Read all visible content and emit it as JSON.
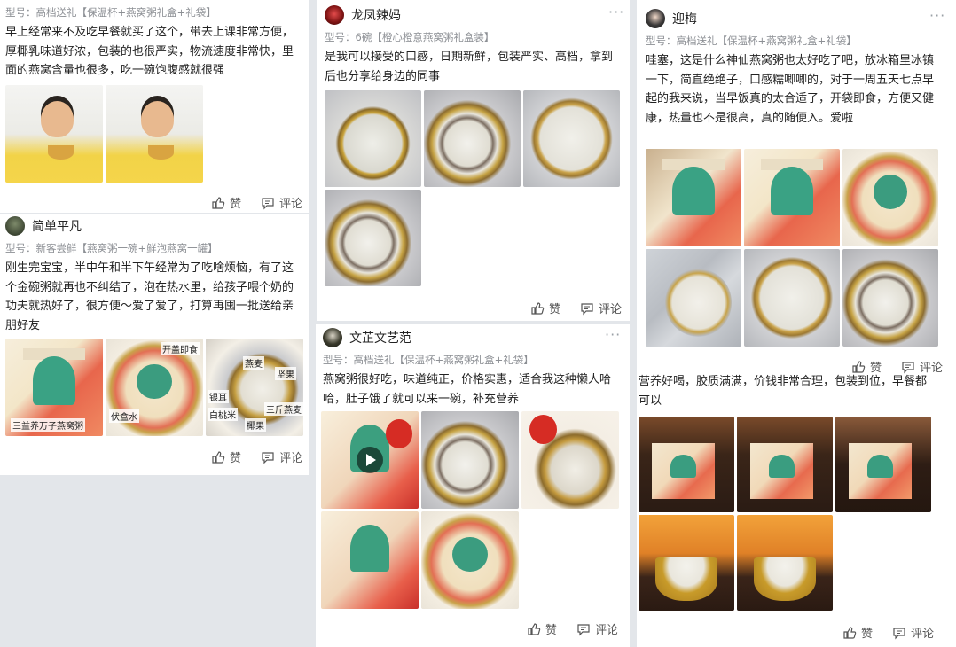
{
  "labels": {
    "like": "赞",
    "comment": "评论",
    "more": "···"
  },
  "posts": [
    {
      "model": "型号：高档送礼【保温杯+燕窝粥礼盒+礼袋】",
      "text": "早上经常来不及吃早餐就买了这个，带去上课非常方便，厚椰乳味道好浓，包装的也很严实，物流速度非常快，里面的燕窝含量也很多，吃一碗饱腹感就很强"
    },
    {
      "user": "简单平凡",
      "model": "型号：新客尝鲜【燕窝粥一碗+鲜泡燕窝一罐】",
      "text": "刚生完宝宝，半中午和半下午经常为了吃啥烦恼，有了这个金碗粥就再也不纠结了，泡在热水里，给孩子喂个奶的功夫就热好了，很方便～爱了爱了，打算再囤一批送给亲朋好友",
      "photo_labels": [
        "三益养万子燕窝粥",
        "开盖即食",
        "伏盒水",
        "燕麦",
        "坚果",
        "银耳",
        "白桃米",
        "椰果",
        "三斤燕麦"
      ]
    },
    {
      "user": "龙凤辣妈",
      "model": "型号：6碗【橙心橙意燕窝粥礼盒装】",
      "text": "是我可以接受的口感，日期新鲜，包装严实、高档，拿到后也分享给身边的同事"
    },
    {
      "user": "文芷文艺范",
      "model": "型号：高档送礼【保温杯+燕窝粥礼盒+礼袋】",
      "text": "燕窝粥很好吃，味道纯正，价格实惠，适合我这种懒人哈哈，肚子饿了就可以来一碗，补充营养"
    },
    {
      "user": "迎梅",
      "model": "型号：高档送礼【保温杯+燕窝粥礼盒+礼袋】",
      "text": "哇塞，这是什么神仙燕窝粥也太好吃了吧，放冰箱里冰镇一下，简直绝绝子，口感糯唧唧的，对于一周五天七点早起的我来说，当早饭真的太合适了，开袋即食，方便又健康，热量也不是很高，真的随便入。爱啦"
    },
    {
      "text": "营养好喝，胶质满满，价钱非常合理，包装到位，早餐都可以"
    }
  ],
  "colors": {
    "background": "#e3e6ea",
    "card": "#ffffff",
    "meta": "#8c8f94",
    "action": "#555555"
  }
}
